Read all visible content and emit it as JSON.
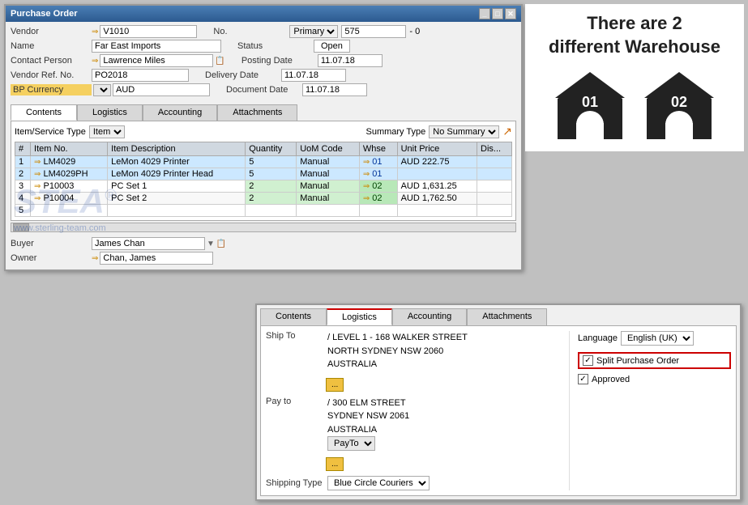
{
  "window": {
    "title": "Purchase Order"
  },
  "header": {
    "vendor_label": "Vendor",
    "vendor_arrow": "⇒",
    "vendor_value": "V1010",
    "name_label": "Name",
    "name_value": "Far East Imports",
    "contact_label": "Contact Person",
    "contact_arrow": "⇒",
    "contact_value": "Lawrence Miles",
    "vendor_ref_label": "Vendor Ref. No.",
    "vendor_ref_value": "PO2018",
    "currency_label": "BP Currency",
    "currency_value": "AUD",
    "no_label": "No.",
    "no_value": "575",
    "no_dash": "- 0",
    "primary_label": "Primary",
    "status_label": "Status",
    "status_value": "Open",
    "posting_label": "Posting Date",
    "posting_value": "11.07.18",
    "delivery_label": "Delivery Date",
    "delivery_value": "11.07.18",
    "document_label": "Document Date",
    "document_value": "11.07.18"
  },
  "tabs": {
    "contents_label": "Contents",
    "logistics_label": "Logistics",
    "accounting_label": "Accounting",
    "attachments_label": "Attachments"
  },
  "contents": {
    "item_type_label": "Item/Service Type",
    "item_type_value": "Item",
    "summary_type_label": "Summary Type",
    "summary_type_value": "No Summary",
    "columns": [
      "#",
      "Item No.",
      "Item Description",
      "Quantity",
      "UoM Code",
      "Whse",
      "Unit Price",
      "Dis..."
    ],
    "rows": [
      {
        "num": "1",
        "item_no": "LM4029",
        "description": "LeMon 4029 Printer",
        "quantity": "5",
        "uom": "Manual",
        "whse": "01",
        "unit_price": "AUD 222.75",
        "disc": ""
      },
      {
        "num": "2",
        "item_no": "LM4029PH",
        "description": "LeMon 4029 Printer Head",
        "quantity": "5",
        "uom": "Manual",
        "whse": "01",
        "unit_price": "",
        "disc": ""
      },
      {
        "num": "3",
        "item_no": "P10003",
        "description": "PC Set 1",
        "quantity": "2",
        "uom": "Manual",
        "whse": "02",
        "unit_price": "AUD 1,631.25",
        "disc": ""
      },
      {
        "num": "4",
        "item_no": "P10004",
        "description": "PC Set 2",
        "quantity": "2",
        "uom": "Manual",
        "whse": "02",
        "unit_price": "AUD 1,762.50",
        "disc": ""
      },
      {
        "num": "5",
        "item_no": "",
        "description": "",
        "quantity": "",
        "uom": "",
        "whse": "",
        "unit_price": "",
        "disc": ""
      }
    ]
  },
  "buyer": {
    "buyer_label": "Buyer",
    "buyer_value": "James Chan",
    "owner_label": "Owner",
    "owner_arrow": "⇒",
    "owner_value": "Chan, James"
  },
  "right_panel": {
    "text_line1": "There are 2",
    "text_line2": "different Warehouse",
    "warehouse1": "01",
    "warehouse2": "02"
  },
  "sub_window": {
    "tabs": {
      "contents": "Contents",
      "logistics": "Logistics",
      "accounting": "Accounting",
      "attachments": "Attachments"
    },
    "ship_to_label": "Ship To",
    "ship_to_value": "/ LEVEL 1 - 168 WALKER STREET\nNORTH SYDNEY NSW 2060\nAUSTRALIA",
    "pay_to_label": "Pay to",
    "pay_to_value": "/ 300 ELM STREET\nSYDNEY NSW 2061\nAUSTRALIA",
    "pay_to_dropdown": "PayTo",
    "shipping_label": "Shipping Type",
    "shipping_value": "Blue Circle Couriers",
    "language_label": "Language",
    "language_value": "English (UK)",
    "split_po_label": "Split Purchase Order",
    "approved_label": "Approved"
  },
  "watermark": {
    "text": "STEA",
    "registered": "®",
    "url": "www.sterling-team.com"
  }
}
